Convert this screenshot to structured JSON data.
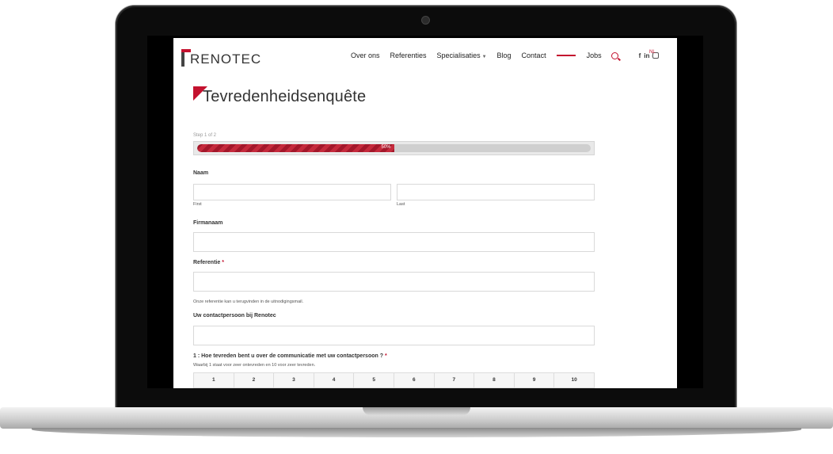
{
  "header": {
    "logo_text": "RENOTEC",
    "nav": [
      "Over ons",
      "Referenties",
      "Specialisaties",
      "Blog",
      "Contact",
      "Jobs"
    ],
    "social": [
      "f",
      "in"
    ],
    "lang": "NL"
  },
  "form": {
    "title": "Tevredenheidsenquête",
    "step_text": "Step 1 of 2",
    "progress_percent": 50,
    "progress_label": "50%",
    "name_label": "Naam",
    "first_label": "First",
    "last_label": "Last",
    "company_label": "Firmanaam",
    "reference_label": "Referentie",
    "required_mark": "*",
    "reference_help": "Onze referentie kan u terugvinden in de uitnodigingsmail.",
    "contact_label": "Uw contactpersoon bij Renotec",
    "question1": "1 : Hoe tevreden bent u over de communicatie met uw contactpersoon ?",
    "question1_help": "Waarbij 1 staat voor zeer ontevreden en 10 voor zeer tevreden.",
    "scale": [
      "1",
      "2",
      "3",
      "4",
      "5",
      "6",
      "7",
      "8",
      "9",
      "10"
    ]
  },
  "colors": {
    "accent": "#c4122f"
  }
}
